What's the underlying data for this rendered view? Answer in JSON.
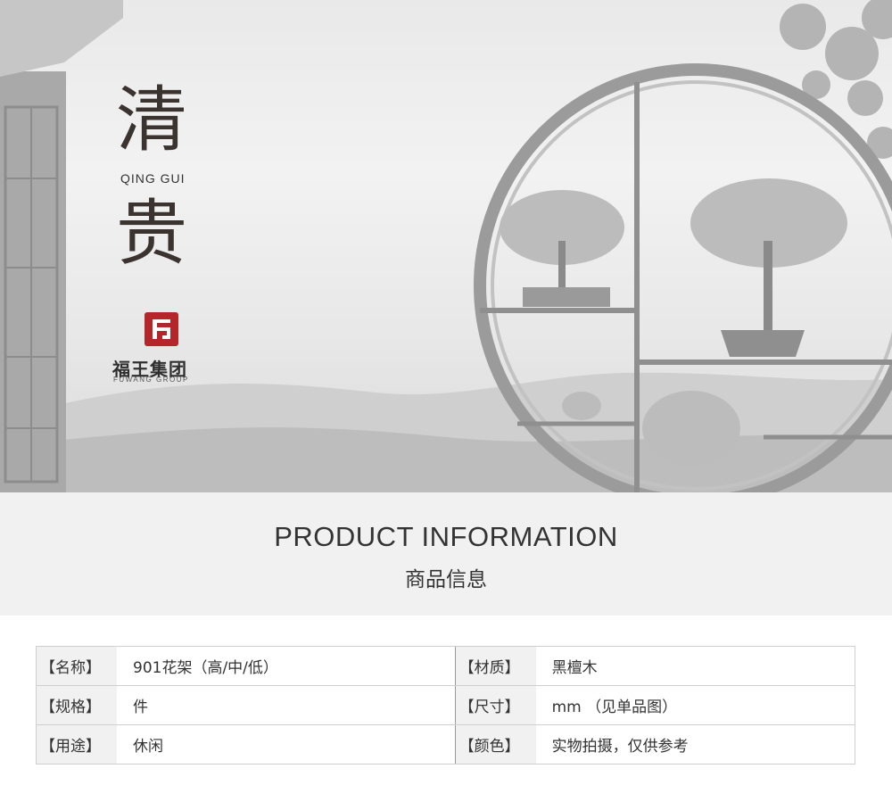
{
  "hero": {
    "char_top": "清",
    "pinyin": "QING GUI",
    "char_bottom": "贵",
    "logo": {
      "mark_letter": "F",
      "name_cn": "福王集团",
      "name_en": "FUWANG GROUP"
    }
  },
  "section": {
    "title_en": "PRODUCT INFORMATION",
    "title_cn": "商品信息"
  },
  "info_rows": [
    {
      "label_left": "【名称】",
      "value_left": "901花架（高/中/低）",
      "label_right": "【材质】",
      "value_right": "黑檀木"
    },
    {
      "label_left": "【规格】",
      "value_left": "件",
      "label_right": "【尺寸】",
      "value_right": "mm （见单品图）"
    },
    {
      "label_left": "【用途】",
      "value_left": "休闲",
      "label_right": "【颜色】",
      "value_right": "实物拍摄，仅供参考"
    }
  ],
  "colors": {
    "brand_red": "#b5262a",
    "band_bg": "#f1f1f1",
    "text": "#333333"
  }
}
